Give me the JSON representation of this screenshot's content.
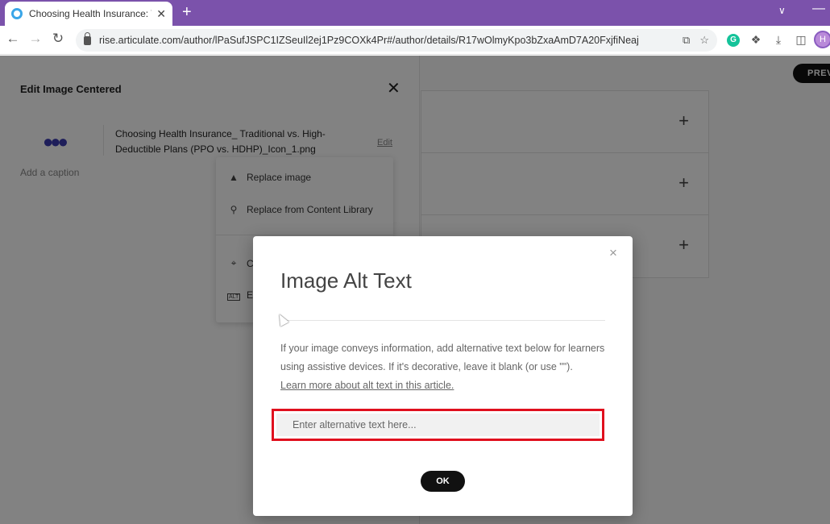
{
  "browser": {
    "tab_title": "Choosing Health Insurance: Trad",
    "tab_close": "✕",
    "new_tab": "+",
    "url": "rise.articulate.com/author/lPaSufJSPC1IZSeuIl2ej1Pz9COXk4Pr#/author/details/R17wOlmyKpo3bZxaAmD7A20FxjfiNeaj",
    "profile_initial": "H"
  },
  "page": {
    "preview_label": "PREV",
    "panel": {
      "title": "Edit Image Centered",
      "add_caption": "Add a caption",
      "file_name": "Choosing Health Insurance_ Traditional vs. High-Deductible Plans (PPO vs. HDHP)_Icon_1.png",
      "edit_label": "Edit",
      "menu": {
        "replace_image": "Replace image",
        "replace_library": "Replace from Content Library",
        "crop": "C",
        "alt": "E"
      }
    },
    "block_plus": "+"
  },
  "modal": {
    "title": "Image Alt Text",
    "description": "If your image conveys information, add alternative text below for learners using assistive devices. If it's decorative, leave it blank (or use \"\").",
    "learn_more": "Learn more about alt text in this article.",
    "input_placeholder": "Enter alternative text here...",
    "ok_label": "OK",
    "close": "×"
  },
  "colors": {
    "tab_strip": "#7b52ab",
    "highlight": "#e0101e",
    "grammarly": "#15c39a"
  }
}
